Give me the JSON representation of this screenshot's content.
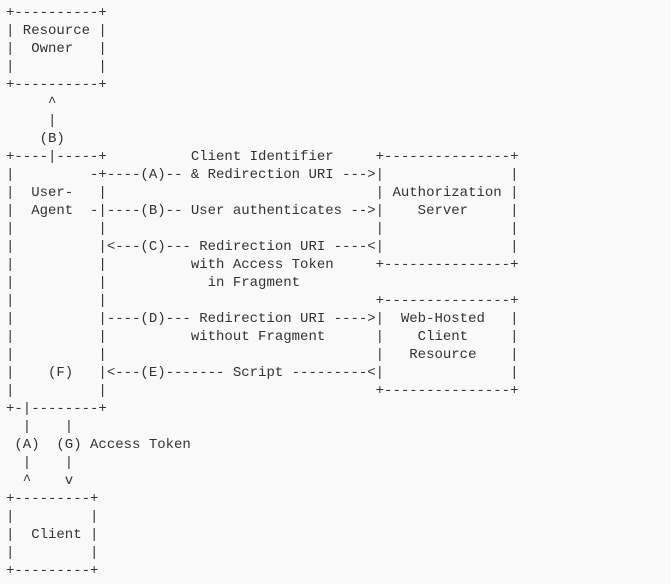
{
  "diagram": {
    "lines": [
      "+----------+",
      "| Resource |",
      "|  Owner   |",
      "|          |",
      "+----------+",
      "     ^",
      "     |",
      "    (B)",
      "+----|-----+          Client Identifier     +---------------+",
      "|         -+----(A)-- & Redirection URI --->|               |",
      "|  User-   |                                | Authorization |",
      "|  Agent  -|----(B)-- User authenticates -->|    Server     |",
      "|          |                                |               |",
      "|          |<---(C)--- Redirection URI ----<|               |",
      "|          |          with Access Token     +---------------+",
      "|          |            in Fragment",
      "|          |                                +---------------+",
      "|          |----(D)--- Redirection URI ---->|  Web-Hosted   |",
      "|          |          without Fragment      |    Client     |",
      "|          |                                |   Resource    |",
      "|    (F)   |<---(E)------- Script ---------<|               |",
      "|          |                                +---------------+",
      "+-|--------+",
      "  |    |",
      " (A)  (G) Access Token",
      "  |    |",
      "  ^    v",
      "+---------+",
      "|         |",
      "|  Client |",
      "|         |",
      "+---------+"
    ]
  },
  "boxes": {
    "resource_owner": "Resource Owner",
    "user_agent": "User-Agent",
    "authorization_server": "Authorization Server",
    "web_hosted_client_resource": "Web-Hosted Client Resource",
    "client": "Client"
  },
  "steps": {
    "A": "Client Identifier & Redirection URI",
    "B": "User authenticates",
    "C": "Redirection URI with Access Token in Fragment",
    "D": "Redirection URI without Fragment",
    "E": "Script",
    "F": "",
    "G": "Access Token"
  }
}
